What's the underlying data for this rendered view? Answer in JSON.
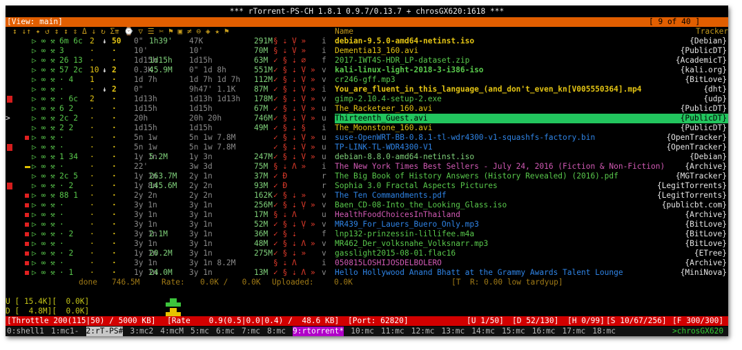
{
  "window_title": "*** rTorrent-PS-CH 1.8.1 0.9.7/0.13.7 + chrosGX620:1618 ***",
  "view": {
    "label": "[View: main]",
    "position": "[ 9 of 40 ]"
  },
  "columns": {
    "left": "↕ ↓↑ ✦ ↺ ↕ ↕ ⇕ Δ ↓ ↻ Σ⇈ ⌚ ▽ ☰ ✂ ⚑ ▣ ≠ ⊖ ◈ ★ ⚑",
    "name": "Name",
    "tracker": "Tracker"
  },
  "torrents": [
    {
      "ind": "",
      "flags": "▷ ∞ ⚒",
      "peers": "6m 6c",
      "pri": "2",
      "dir": "↡",
      "done": "50",
      "up": "0\"",
      "age": "1h39'",
      "ratio": "47K",
      "size": "291M",
      "sym": "§ ⇣ Ṿ »",
      "tp": "i",
      "name": "debian-9.5.0-amd64-netinst.iso",
      "tracker": "{Debian}",
      "color": "c-y",
      "bold": true
    },
    {
      "ind": "",
      "flags": "▷ ∞ ⚒",
      "peers": "3",
      "pri": "·",
      "dir": "",
      "done": "·",
      "up": "10'",
      "age": "",
      "ratio": "10'",
      "size": "70M",
      "sym": "§ ⇣ Ṿ »",
      "tp": "i",
      "name": "Dementia13_160.avi",
      "tracker": "{PublicDT}",
      "color": "c-y",
      "bold": false
    },
    {
      "ind": "",
      "flags": "▷ ∞ ⚒",
      "peers": "26 13",
      "pri": "·",
      "dir": "",
      "done": "·",
      "up": "1d15h",
      "age": "1d15h",
      "ratio": "1d15h",
      "size": "63M",
      "sym": "✓ § ⇣ ∅",
      "tp": "f",
      "name": "2017-IWT4S-HDR_LP-dataset.zip",
      "tracker": "{AcademicT}",
      "color": "c-g",
      "bold": false
    },
    {
      "ind": "",
      "flags": "▷ ∞ ⚒",
      "peers": "57 2c",
      "pri": "10",
      "dir": "↡",
      "done": "2",
      "up": "0.3K",
      "age": "45.9M",
      "ratio": "0\" 1d 8h",
      "size": "551M",
      "sym": "✓ § ⇣ Ṿ »",
      "tp": "v",
      "name": "kali-linux-light-2018-3-i386-iso",
      "tracker": "{kali.org}",
      "color": "c-g",
      "bold": true
    },
    {
      "ind": "",
      "flags": "▷ ∞ ⚒",
      "peers": "· 4",
      "pri": "1",
      "dir": "",
      "done": "·",
      "up": "1d 7h",
      "age": "",
      "ratio": "1d 7h 1d 7h",
      "size": "112M",
      "sym": "✓ § ⇣ Ṿ »",
      "tp": "v",
      "name": "cr246-gff.mp3",
      "tracker": "{BitLove}",
      "color": "c-g",
      "bold": false
    },
    {
      "ind": "",
      "flags": "▷ ∞ ⚒",
      "peers": "·",
      "pri": "·",
      "dir": "↡",
      "done": "2",
      "up": "0\"",
      "age": "",
      "ratio": "9h47' 1.1K",
      "size": "87M",
      "sym": "✓ § ⇣ Ṿ »",
      "tp": "i",
      "name": "You_are_fluent_in_this_language_(and_don't_even_kn[V005550364].mp4",
      "tracker": "{dht}",
      "color": "c-y",
      "bold": true
    },
    {
      "ind": "flag-red",
      "flags": "▷ ∞ ⚒",
      "peers": "· 6c",
      "pri": "2",
      "dir": "",
      "done": "·",
      "up": "1d13h",
      "age": "",
      "ratio": "1d13h 1d13h",
      "size": "178M",
      "sym": "✓ § ⇣ Ṿ »",
      "tp": "v",
      "name": "gimp-2.10.4-setup-2.exe",
      "tracker": "{udp}",
      "color": "c-g",
      "bold": false
    },
    {
      "ind": "",
      "flags": "▷ ∞ ⚒",
      "peers": "6 2",
      "pri": "·",
      "dir": "",
      "done": "·",
      "up": "1d15h",
      "age": "",
      "ratio": "1d15h",
      "size": "67M",
      "sym": "✓ § ⇣ Ṿ »",
      "tp": "u",
      "name": "The_Racketeer_160.avi",
      "tracker": "{PublicDT}",
      "color": "c-y",
      "bold": false
    },
    {
      "ind": "cursor",
      "flags": "▷ ∞ ⚒",
      "peers": "2c 2",
      "pri": "·",
      "dir": "",
      "done": "·",
      "up": "20h",
      "age": "",
      "ratio": "20h 20h",
      "size": "746M",
      "sym": "✓ § ⇣ Ṿ »",
      "tp": "u",
      "name": "Thirteenth_Guest.avi",
      "tracker": "{PublicDT}",
      "color": "c-y",
      "bold": false,
      "selected": true
    },
    {
      "ind": "",
      "flags": "▷ ∞ ⚒",
      "peers": "2 2",
      "pri": "·",
      "dir": "",
      "done": "·",
      "up": "1d15h",
      "age": "",
      "ratio": "1d15h",
      "size": "49M",
      "sym": "✓ § ⇣ §",
      "tp": "i",
      "name": "The_Moonstone_160.avi",
      "tracker": "{PublicDT}",
      "color": "c-y",
      "bold": false
    },
    {
      "ind": "sq-red",
      "flags": "▷ ∞ ⚒",
      "peers": "·",
      "pri": "·",
      "dir": "",
      "done": "·",
      "up": "5n 1w",
      "age": "",
      "ratio": "5n 1w 7.8M",
      "size": "",
      "sym": "✓ § ⇣ Ṿ »",
      "tp": "u",
      "name": "suse-OpenWRT-BB-0.8.1-tl-wdr4300-v1-squashfs-factory.bin",
      "tracker": "{OpenTracker}",
      "color": "c-b",
      "bold": false
    },
    {
      "ind": "flag-red2",
      "flags": "▷ ∞ ⚒",
      "peers": "·",
      "pri": "·",
      "dir": "",
      "done": "·",
      "up": "5n 1w",
      "age": "",
      "ratio": "5n 1w 7.8M",
      "size": "",
      "sym": "✓ § ⇣ Ṿ »",
      "tp": "u",
      "name": "TP-LINK-TL-WDR4300-V1",
      "tracker": "{OpenTracker}",
      "color": "c-b",
      "bold": false
    },
    {
      "ind": "",
      "flags": "▷ ∞ ⚒",
      "peers": "1 34",
      "pri": "·",
      "dir": "",
      "done": "·",
      "up": "1y 1n",
      "age": "5.2M",
      "ratio": "1y 3n",
      "size": "247M",
      "sym": "✓ § ⇣ Ṿ »",
      "tp": "u",
      "name": "debian-8.8.0-amd64-netinst.iso",
      "tracker": "{Debian}",
      "color": "c-gl",
      "bold": false
    },
    {
      "ind": "dash",
      "flags": "▷ ∞ ⚒",
      "peers": "·",
      "pri": "·",
      "dir": "",
      "done": "·",
      "up": "22'",
      "age": "",
      "ratio": "3w 3d",
      "size": "75M",
      "sym": "§ ⇣ Λ »",
      "tp": "i",
      "name": "The New York Times Best Sellers - July 24, 2016 (Fiction & Non-Fiction)",
      "tracker": "{Archive}",
      "color": "c-m",
      "bold": false
    },
    {
      "ind": "",
      "flags": "▷ ∞ ⚒",
      "peers": "2c 5",
      "pri": "·",
      "dir": "",
      "done": "·",
      "up": "1y 1n",
      "age": "263.7M",
      "ratio": "2y 1n",
      "size": "37M",
      "sym": "✓ Đ",
      "tp": "r",
      "name": "The Big Book of History Answers (History Revealed) (2016).pdf",
      "tracker": "{MGTracker}",
      "color": "c-g",
      "bold": false
    },
    {
      "ind": "flag-red3",
      "flags": "▷ ∞ ⚒",
      "peers": "· 2",
      "pri": "·",
      "dir": "",
      "done": "·",
      "up": "1y 8n",
      "age": "145.6M",
      "ratio": "2y 2n",
      "size": "93M",
      "sym": "✓ Đ",
      "tp": "r",
      "name": "Sophia 3.0 Fractal Aspects Pictures",
      "tracker": "{LegitTorrents}",
      "color": "c-g",
      "bold": false
    },
    {
      "ind": "sq-red",
      "flags": "▷ ∞ ⚒",
      "peers": "88 1",
      "pri": "·",
      "dir": "",
      "done": "·",
      "up": "2y 2n",
      "age": "",
      "ratio": "2y 2n",
      "size": "162K",
      "sym": "✓ § ⇣ »",
      "tp": "v",
      "name": "The Ten Commandments.pdf",
      "tracker": "{LegitTorrents}",
      "color": "c-b",
      "bold": false
    },
    {
      "ind": "sq-red",
      "flags": "▷ ∞ ⚒",
      "peers": "·",
      "pri": "·",
      "dir": "",
      "done": "·",
      "up": "3y 1n",
      "age": "",
      "ratio": "3y 1n",
      "size": "256M",
      "sym": "✓ § ⇣ Ṿ »",
      "tp": "v",
      "name": "Baen_CD-08-Into_the_Looking_Glass.iso",
      "tracker": "{publicbt.com}",
      "color": "c-g",
      "bold": false
    },
    {
      "ind": "sq-red",
      "flags": "▷ ∞ ⚒",
      "peers": "·",
      "pri": "·",
      "dir": "",
      "done": "·",
      "up": "3y 1n",
      "age": "",
      "ratio": "3y 1n",
      "size": "17M",
      "sym": "§ ⇣ Λ",
      "tp": "u",
      "name": "HealthFoodChoicesInThailand",
      "tracker": "{Archive}",
      "color": "c-m",
      "bold": false
    },
    {
      "ind": "sq-red",
      "flags": "▷ ∞ ⚒",
      "peers": "·",
      "pri": "·",
      "dir": "",
      "done": "·",
      "up": "3y 1n",
      "age": "",
      "ratio": "3y 1n",
      "size": "52M",
      "sym": "✓ § ⇣ Ṿ »",
      "tp": "v",
      "name": "MR439_For_Lauers_Buero_Only.mp3",
      "tracker": "{BitLove}",
      "color": "c-b",
      "bold": false
    },
    {
      "ind": "sq-red",
      "flags": "▷ ∞ ⚒",
      "peers": "· 2",
      "pri": "·",
      "dir": "",
      "done": "·",
      "up": "3y 1n",
      "age": "2.1M",
      "ratio": "3y 1n",
      "size": "36M",
      "sym": "✓ § ⇣",
      "tp": "f",
      "name": "lnp132-prinzessin-lillifee.m4a",
      "tracker": "{BitLove}",
      "color": "c-g",
      "bold": false
    },
    {
      "ind": "sq-red",
      "flags": "▷ ∞ ⚒",
      "peers": "·",
      "pri": "·",
      "dir": "",
      "done": "·",
      "up": "3y 1n",
      "age": "",
      "ratio": "3y 1n",
      "size": "48M",
      "sym": "✓ § ⇣ Λ »",
      "tp": "v",
      "name": "MR462_Der_volksnahe_Volksnarr.mp3",
      "tracker": "{BitLove}",
      "color": "c-g",
      "bold": false
    },
    {
      "ind": "sq-red",
      "flags": "▷ ∞ ⚒",
      "peers": "· 2",
      "pri": "·",
      "dir": "",
      "done": "·",
      "up": "1y 1n",
      "age": "20.2M",
      "ratio": "3y 1n",
      "size": "275M",
      "sym": "✓ § ⇣ »",
      "tp": "v",
      "name": "gasslight2015-08-01.flac16",
      "tracker": "{ETree}",
      "color": "c-g",
      "bold": false
    },
    {
      "ind": "sq-red",
      "flags": "▷ ∞ ⚒",
      "peers": "·",
      "pri": "·",
      "dir": "",
      "done": "·",
      "up": "3y 1n",
      "age": "",
      "ratio": "3y 1n 8.2M",
      "size": "",
      "sym": "§ ⇣ Λ",
      "tp": "i",
      "name": "050815LOSHIJOSDELBOLERO",
      "tracker": "{Archive}",
      "color": "c-m",
      "bold": false
    },
    {
      "ind": "sq-red",
      "flags": "▷ ∞ ⚒",
      "peers": "· 1",
      "pri": "·",
      "dir": "",
      "done": "·",
      "up": "1y 1n",
      "age": "24.0M",
      "ratio": "3y 1n",
      "size": "13M",
      "sym": "✓ § ⇣ Λ »",
      "tp": "v",
      "name": "Hello Hollywood Anand Bhatt at the Grammy Awards Talent Lounge",
      "tracker": "{MiniNova}",
      "color": "c-b",
      "bold": false
    }
  ],
  "footer": {
    "done_label": "done",
    "done_value": "746.5M",
    "rate_label": "Rate:",
    "rate_value": "0.0K /   0.0K",
    "uploaded_label": "Uploaded:",
    "uploaded_value": "0.0K",
    "tr_text": "[T  R: 0.00 low tardyup]"
  },
  "rates": {
    "up": "U [ 15.4K][  0.0K]",
    "down": "D [  4.8M][  0.0K]"
  },
  "statusbar": {
    "throttle": "[Throttle 200(115|50) / 5000 KB]",
    "rate": "[Rate    0.9(0.5|0.0|0.4) /  48.6 KB]",
    "port": "[Port: 62820]",
    "u": "[U 1/50]",
    "d": "[D 52/130]",
    "h": "[H 0/99]",
    "s": "[S 10/67/256]",
    "f": "[F 300/300]"
  },
  "tmux": {
    "windows": [
      "0:shell1",
      "1:mc1-",
      "2:rT-PS#",
      "3:mc2",
      "4:mcM",
      "5:mc",
      "6:mc",
      "7:mc",
      "8:mc",
      "9:rtorrent*",
      "10:mc",
      "11:mc",
      "12:mc",
      "13:mc",
      "14:mc",
      "15:mc",
      "16:mc",
      "17:mc",
      "18:mc"
    ],
    "host": ">chrosGX620"
  }
}
